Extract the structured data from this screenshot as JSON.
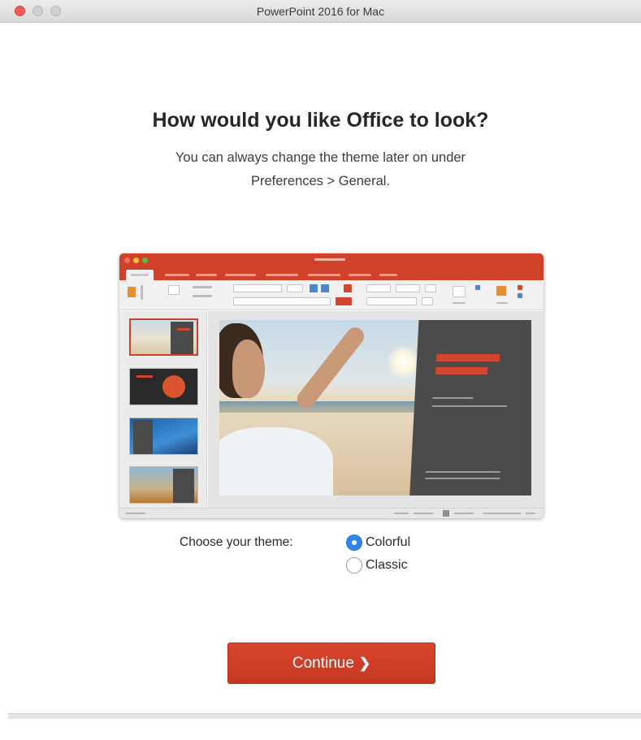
{
  "window": {
    "title": "PowerPoint 2016 for Mac"
  },
  "heading": "How would you like Office to look?",
  "subtext": {
    "line1": "You can always change the theme later on under",
    "line2": "Preferences > General."
  },
  "theme_choice": {
    "label": "Choose your theme:",
    "options": [
      {
        "label": "Colorful",
        "selected": true
      },
      {
        "label": "Classic",
        "selected": false
      }
    ]
  },
  "continue_button": {
    "label": "Continue",
    "chevron": "❯"
  },
  "colors": {
    "accent": "#c8432c",
    "radio_selected": "#2f86ea"
  },
  "icons": [
    "close-icon",
    "minimize-icon",
    "zoom-icon",
    "chevron-right-icon"
  ]
}
